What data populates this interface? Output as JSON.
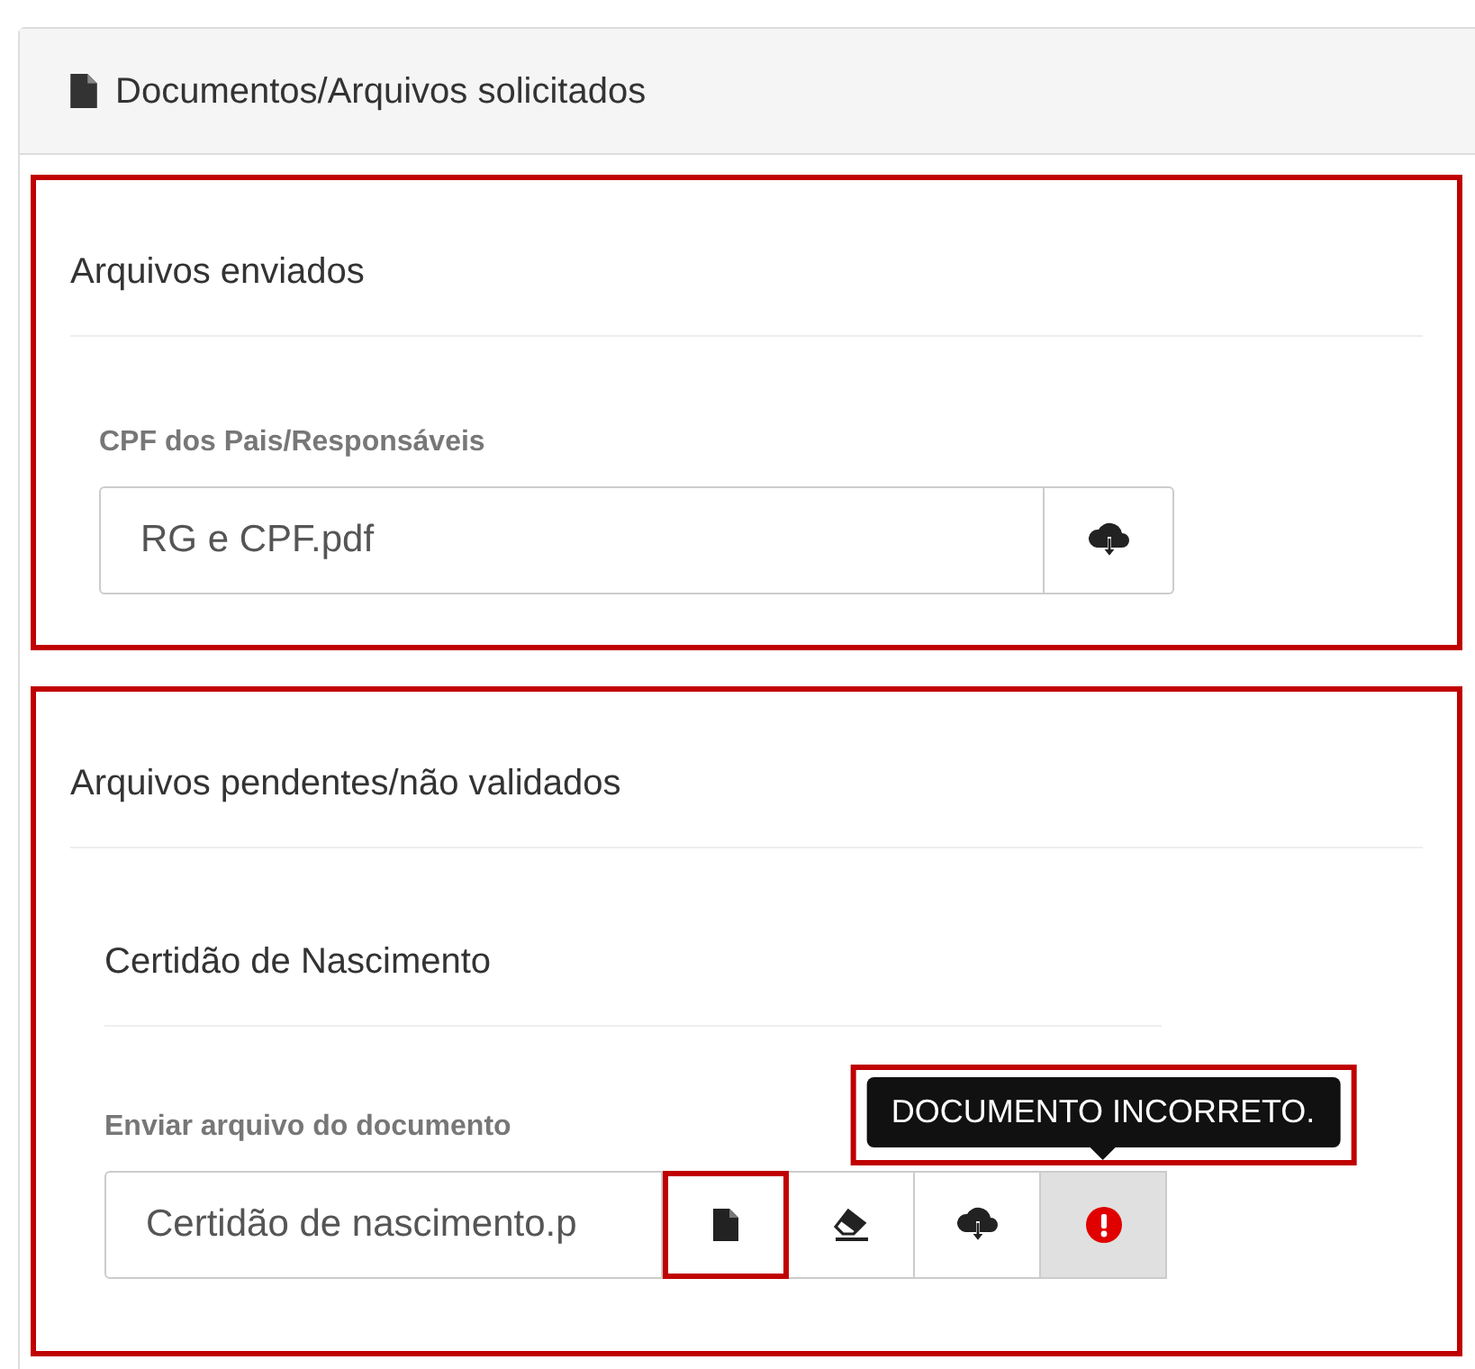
{
  "panel": {
    "title": "Documentos/Arquivos solicitados"
  },
  "sections": [
    {
      "title": "Arquivos enviados",
      "highlighted": true,
      "kind": "sent",
      "field": {
        "label": "CPF dos Pais/Responsáveis",
        "value": "RG e CPF.pdf"
      }
    },
    {
      "title": "Arquivos pendentes/não validados",
      "highlighted": true,
      "kind": "pending",
      "document": {
        "title": "Certidão de Nascimento",
        "field": {
          "label": "Enviar arquivo do documento",
          "value": "Certidão de nascimento.p"
        },
        "buttons": [
          {
            "kind": "file",
            "highlighted": true,
            "selected": false
          },
          {
            "kind": "eraser",
            "highlighted": false,
            "selected": false
          },
          {
            "kind": "download",
            "highlighted": false,
            "selected": false
          },
          {
            "kind": "error",
            "highlighted": false,
            "selected": true
          }
        ],
        "tooltip": {
          "text": "DOCUMENTO INCORRETO.",
          "highlighted": true
        }
      }
    }
  ]
}
